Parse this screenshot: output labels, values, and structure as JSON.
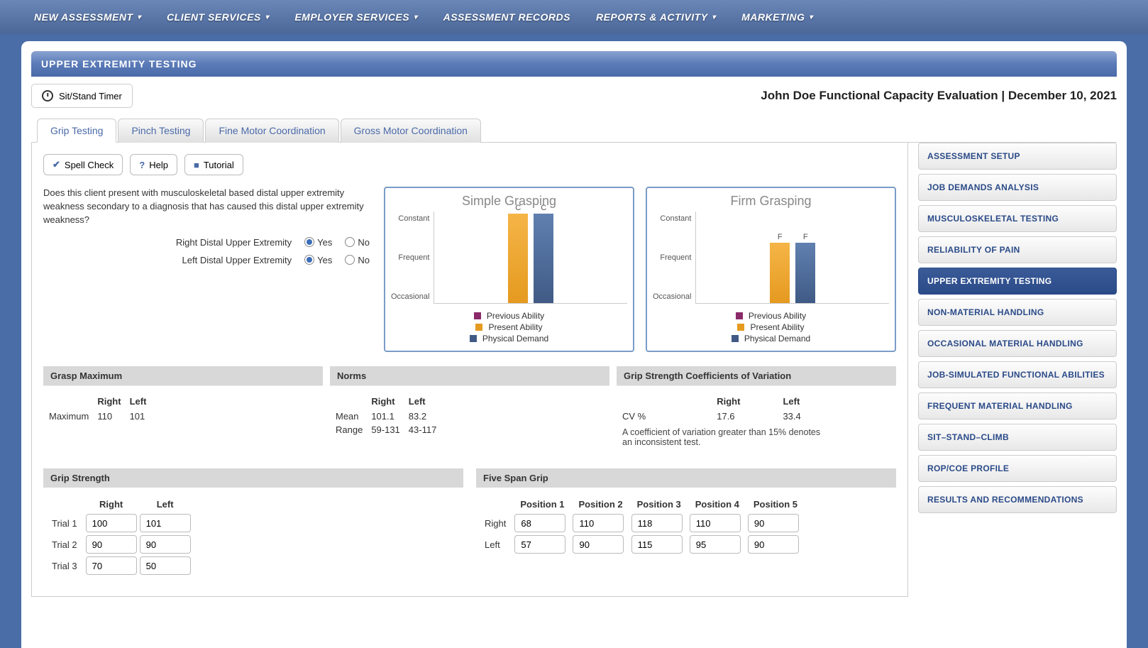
{
  "topnav": [
    {
      "label": "NEW ASSESSMENT",
      "hasMenu": true
    },
    {
      "label": "CLIENT SERVICES",
      "hasMenu": true
    },
    {
      "label": "EMPLOYER SERVICES",
      "hasMenu": true
    },
    {
      "label": "ASSESSMENT RECORDS",
      "hasMenu": false
    },
    {
      "label": "REPORTS & ACTIVITY",
      "hasMenu": true
    },
    {
      "label": "MARKETING",
      "hasMenu": true
    }
  ],
  "panel_title": "UPPER EXTREMITY TESTING",
  "timer_label": "Sit/Stand Timer",
  "page_title": "John Doe Functional Capacity Evaluation | December 10, 2021",
  "tabs": [
    "Grip Testing",
    "Pinch Testing",
    "Fine Motor Coordination",
    "Gross Motor Coordination"
  ],
  "active_tab": 0,
  "toolbar": {
    "spellcheck": "Spell Check",
    "help": "Help",
    "tutorial": "Tutorial"
  },
  "question": "Does this client present with musculoskeletal based distal upper extremity weakness secondary to a diagnosis that has caused this distal upper extremity weakness?",
  "radio_rows": [
    {
      "label": "Right Distal Upper Extremity",
      "yes": "Yes",
      "no": "No",
      "selected": "yes"
    },
    {
      "label": "Left Distal Upper Extremity",
      "yes": "Yes",
      "no": "No",
      "selected": "yes"
    }
  ],
  "chart_y_labels": [
    "Constant",
    "Frequent",
    "Occasional"
  ],
  "legend": {
    "previous": "Previous Ability",
    "present": "Present Ability",
    "demand": "Physical Demand"
  },
  "chart_data": [
    {
      "type": "bar",
      "title": "Simple Grasping",
      "y_categories": [
        "Occasional",
        "Frequent",
        "Constant"
      ],
      "series": [
        {
          "name": "Previous Ability",
          "value": null,
          "label": ""
        },
        {
          "name": "Present Ability",
          "value": 3,
          "label": "C"
        },
        {
          "name": "Physical Demand",
          "value": 3,
          "label": "C"
        }
      ]
    },
    {
      "type": "bar",
      "title": "Firm Grasping",
      "y_categories": [
        "Occasional",
        "Frequent",
        "Constant"
      ],
      "series": [
        {
          "name": "Previous Ability",
          "value": null,
          "label": ""
        },
        {
          "name": "Present Ability",
          "value": 2,
          "label": "F"
        },
        {
          "name": "Physical Demand",
          "value": 2,
          "label": "F"
        }
      ]
    }
  ],
  "grasp_max": {
    "header": "Grasp Maximum",
    "cols": [
      "Right",
      "Left"
    ],
    "row_label": "Maximum",
    "right": "110",
    "left": "101"
  },
  "norms": {
    "header": "Norms",
    "cols": [
      "Right",
      "Left"
    ],
    "mean_label": "Mean",
    "mean_right": "101.1",
    "mean_left": "83.2",
    "range_label": "Range",
    "range_right": "59-131",
    "range_left": "43-117"
  },
  "cv": {
    "header": "Grip Strength Coefficients of Variation",
    "cols": [
      "Right",
      "Left"
    ],
    "row_label": "CV %",
    "right": "17.6",
    "left": "33.4",
    "note": "A coefficient of variation greater than 15% denotes an inconsistent test."
  },
  "grip_strength": {
    "header": "Grip Strength",
    "cols": [
      "Right",
      "Left"
    ],
    "trials": [
      {
        "label": "Trial 1",
        "right": "100",
        "left": "101"
      },
      {
        "label": "Trial 2",
        "right": "90",
        "left": "90"
      },
      {
        "label": "Trial 3",
        "right": "70",
        "left": "50"
      }
    ]
  },
  "five_span": {
    "header": "Five Span Grip",
    "cols": [
      "Position 1",
      "Position 2",
      "Position 3",
      "Position 4",
      "Position 5"
    ],
    "rows": [
      {
        "label": "Right",
        "vals": [
          "68",
          "110",
          "118",
          "110",
          "90"
        ]
      },
      {
        "label": "Left",
        "vals": [
          "57",
          "90",
          "115",
          "95",
          "90"
        ]
      }
    ]
  },
  "sidebar": [
    "ASSESSMENT SETUP",
    "JOB DEMANDS ANALYSIS",
    "MUSCULOSKELETAL TESTING",
    "RELIABILITY OF PAIN",
    "UPPER EXTREMITY TESTING",
    "NON-MATERIAL HANDLING",
    "OCCASIONAL MATERIAL HANDLING",
    "JOB-SIMULATED FUNCTIONAL ABILITIES",
    "FREQUENT MATERIAL HANDLING",
    "SIT–STAND–CLIMB",
    "ROP/COE PROFILE",
    "RESULTS AND RECOMMENDATIONS"
  ],
  "sidebar_active": 4
}
